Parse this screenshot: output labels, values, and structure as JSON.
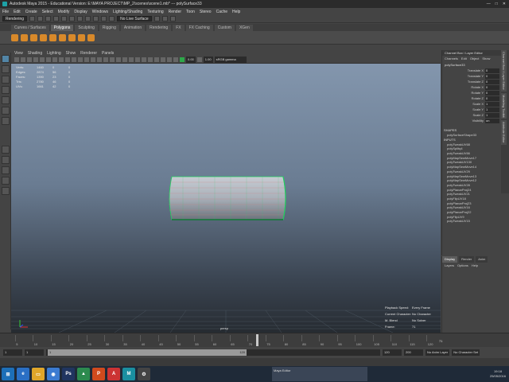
{
  "titlebar": {
    "text": "Autodesk Maya 2015 - Educational Version: E:\\MAYA PROJECT\\MP_2\\scenes\\scene1.mb*  ---  polySurface33",
    "controls": [
      "—",
      "□",
      "✕"
    ]
  },
  "menubar": {
    "items": [
      "File",
      "Edit",
      "Create",
      "Select",
      "Modify",
      "Display",
      "Windows",
      "Lighting/Shading",
      "Texturing",
      "Render",
      "Toon",
      "Stereo",
      "Cache",
      "Help"
    ]
  },
  "statusline": {
    "mode": "Rendering",
    "no_live_surface": "No Live Surface"
  },
  "shelf": {
    "tabs": [
      "Curves / Surfaces",
      "Polygons",
      "Sculpting",
      "Rigging",
      "Animation",
      "Rendering",
      "FX",
      "FX Caching",
      "Custom",
      "XGen"
    ],
    "active_tab": "Polygons"
  },
  "panel": {
    "menu": [
      "View",
      "Shading",
      "Lighting",
      "Show",
      "Renderer",
      "Panels"
    ],
    "exposure": "0.00",
    "gamma": "1.00",
    "color_space": "sRGB gamma"
  },
  "hud": {
    "rows": [
      {
        "label": "Verts:",
        "a": "1460",
        "b": "0",
        "c": "0"
      },
      {
        "label": "Edges:",
        "a": "2874",
        "b": "56",
        "c": "0"
      },
      {
        "label": "Faces:",
        "a": "1390",
        "b": "23",
        "c": "0"
      },
      {
        "label": "Tris:",
        "a": "2780",
        "b": "46",
        "c": "0"
      },
      {
        "label": "UVs:",
        "a": "1661",
        "b": "42",
        "c": "0"
      }
    ],
    "camera": "persp",
    "playback_label": "Playback Speed:",
    "playback_value": "Every Frame",
    "char_label": "Current Character:",
    "char_value": "No Character",
    "blend_label": "M. Blend",
    "blend_value": "No Solver",
    "frame_label": "Frame:",
    "frame_value": "71"
  },
  "channelbox": {
    "title": "Channel Box / Layer Editor",
    "menu": [
      "Channels",
      "Edit",
      "Object",
      "Show"
    ],
    "object": "polySurface33",
    "attrs": [
      {
        "name": "Translate X",
        "value": "0"
      },
      {
        "name": "Translate Y",
        "value": "0"
      },
      {
        "name": "Translate Z",
        "value": "0"
      },
      {
        "name": "Rotate X",
        "value": "0"
      },
      {
        "name": "Rotate Y",
        "value": "0"
      },
      {
        "name": "Rotate Z",
        "value": "0"
      },
      {
        "name": "Scale X",
        "value": "1"
      },
      {
        "name": "Scale Y",
        "value": "1"
      },
      {
        "name": "Scale Z",
        "value": "1"
      },
      {
        "name": "Visibility",
        "value": "on"
      }
    ],
    "shapes_label": "SHAPES",
    "shape": "polySurfaceShape33",
    "inputs_label": "INPUTS",
    "inputs": [
      "polyTweakUV68",
      "polySplitq4",
      "polyTweakUV66",
      "polyMapSewMove17",
      "polyTweakUV130",
      "polyMapSewMove14",
      "polyTweakUV29",
      "polyMapSewMove13",
      "polyMapSewMove12",
      "polyTweakUV28",
      "polyPlanarProj24",
      "polyTweakUV21",
      "polyFlipUV18",
      "polyPlanarProj23",
      "polyTweakUV16",
      "polyPlanarProj22",
      "polyFlipUV9",
      "polyTweakUV15"
    ]
  },
  "sidetabs": [
    "Channel Box / Layer Editor",
    "Modeling Toolkit",
    "Attribute Editor"
  ],
  "layer": {
    "tabs": [
      "Display",
      "Render",
      "Anim"
    ],
    "menu": [
      "Layers",
      "Options",
      "Help"
    ]
  },
  "time": {
    "ticks": [
      "5",
      "10",
      "15",
      "20",
      "25",
      "30",
      "35",
      "40",
      "45",
      "50",
      "55",
      "60",
      "65",
      "70",
      "75",
      "80",
      "85",
      "90",
      "95",
      "100",
      "105",
      "110",
      "115",
      "120"
    ],
    "current": "71",
    "range_start": "1",
    "range_start2": "1",
    "range_inner": "1",
    "range_end_inner": "120",
    "range_end": "120",
    "range_end2": "200",
    "anim_layer": "No Anim Layer",
    "char_set": "No Character Set"
  },
  "taskbar": {
    "time": "19:18",
    "date": "25/05/2016",
    "maya_window": "Maya Editor"
  },
  "colors": {
    "wire": "#1fd15e",
    "selection_green": "#33d16b"
  }
}
